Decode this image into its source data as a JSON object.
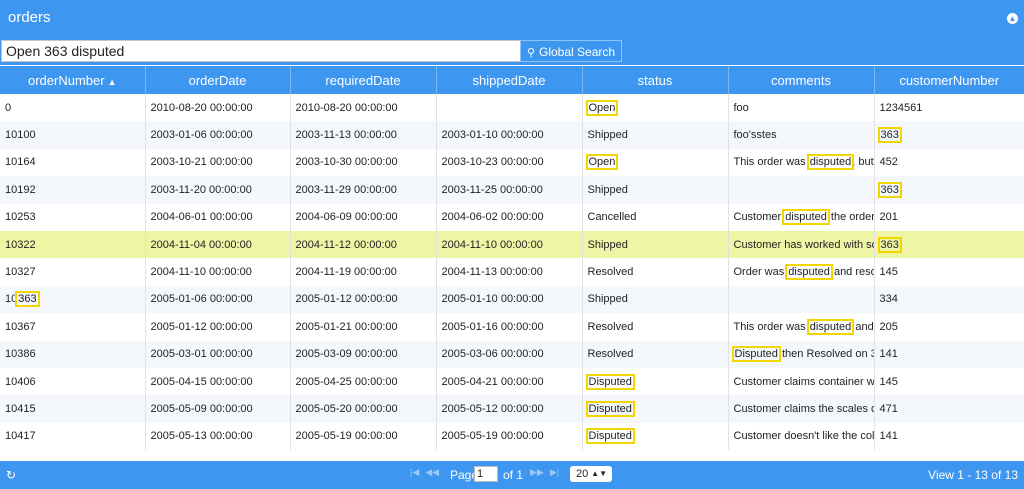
{
  "header": {
    "title": "orders"
  },
  "search": {
    "value": "Open 363 disputed",
    "button_label": "Global Search"
  },
  "columns": [
    "orderNumber",
    "orderDate",
    "requiredDate",
    "shippedDate",
    "status",
    "comments",
    "customerNumber"
  ],
  "rows": [
    [
      "0",
      "2010-08-20 00:00:00",
      "2010-08-20 00:00:00",
      "",
      "Open",
      "foo",
      "1234561"
    ],
    [
      "10100",
      "2003-01-06 00:00:00",
      "2003-11-13 00:00:00",
      "2003-01-10 00:00:00",
      "Shipped",
      "foo'sstes",
      "363"
    ],
    [
      "10164",
      "2003-10-21 00:00:00",
      "2003-10-30 00:00:00",
      "2003-10-23 00:00:00",
      "Open",
      "This order was disputed, but",
      "452"
    ],
    [
      "10192",
      "2003-11-20 00:00:00",
      "2003-11-29 00:00:00",
      "2003-11-25 00:00:00",
      "Shipped",
      "",
      "363"
    ],
    [
      "10253",
      "2004-06-01 00:00:00",
      "2004-06-09 00:00:00",
      "2004-06-02 00:00:00",
      "Cancelled",
      "Customer disputed the order",
      "201"
    ],
    [
      "10322",
      "2004-11-04 00:00:00",
      "2004-11-12 00:00:00",
      "2004-11-10 00:00:00",
      "Shipped",
      "Customer has worked with so",
      "363"
    ],
    [
      "10327",
      "2004-11-10 00:00:00",
      "2004-11-19 00:00:00",
      "2004-11-13 00:00:00",
      "Resolved",
      "Order was disputed and reso",
      "145"
    ],
    [
      "10363",
      "2005-01-06 00:00:00",
      "2005-01-12 00:00:00",
      "2005-01-10 00:00:00",
      "Shipped",
      "",
      "334"
    ],
    [
      "10367",
      "2005-01-12 00:00:00",
      "2005-01-21 00:00:00",
      "2005-01-16 00:00:00",
      "Resolved",
      "This order was disputed and",
      "205"
    ],
    [
      "10386",
      "2005-03-01 00:00:00",
      "2005-03-09 00:00:00",
      "2005-03-06 00:00:00",
      "Resolved",
      "Disputed then Resolved on 3/",
      "141"
    ],
    [
      "10406",
      "2005-04-15 00:00:00",
      "2005-04-25 00:00:00",
      "2005-04-21 00:00:00",
      "Disputed",
      "Customer claims container w",
      "145"
    ],
    [
      "10415",
      "2005-05-09 00:00:00",
      "2005-05-20 00:00:00",
      "2005-05-12 00:00:00",
      "Disputed",
      "Customer claims the scales o",
      "471"
    ],
    [
      "10417",
      "2005-05-13 00:00:00",
      "2005-05-19 00:00:00",
      "2005-05-19 00:00:00",
      "Disputed",
      "Customer doesn't like the col",
      "141"
    ]
  ],
  "highlight_terms": [
    "Open",
    "363",
    "disputed"
  ],
  "selected_row": 5,
  "footer": {
    "page_label": "Page",
    "page_value": "1",
    "of_label": "of 1",
    "page_size": "20",
    "view_text": "View 1 - 13 of 13"
  },
  "colors": {
    "accent": "#3d97f0",
    "highlight": "#f2d600",
    "selected_row": "#eef6a6"
  },
  "icons": {
    "collapse": "circle-chevron-up-icon",
    "search": "search-icon",
    "refresh": "refresh-icon"
  }
}
